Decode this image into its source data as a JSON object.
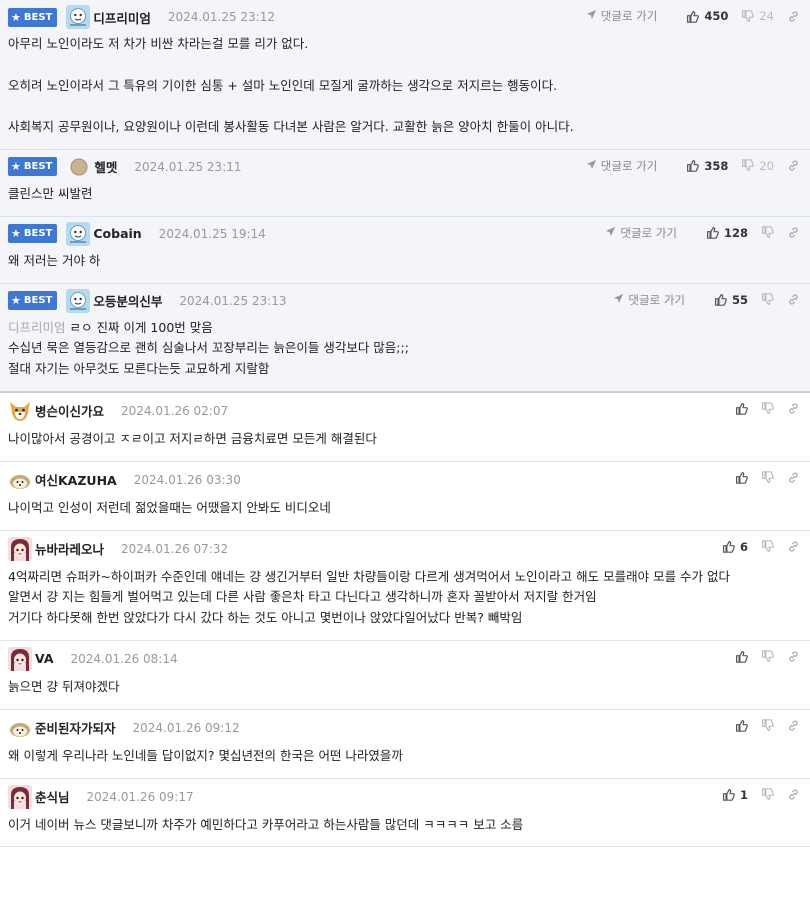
{
  "labels": {
    "best_badge": "BEST",
    "reply_link": "댓글로 가기"
  },
  "comments": [
    {
      "best": true,
      "nick": "디프리미엄",
      "avatar": "ice-character",
      "date": "2024.01.25 23:12",
      "likes": "450",
      "dislikes": "24",
      "lines": [
        "아무리 노인이라도 저 차가 비싼 차라는걸 모를 리가 없다.",
        "",
        "오히려 노인이라서 그 특유의 기이한 심통 + 설마 노인인데 모질게 굴까하는 생각으로 저지르는 행동이다.",
        "",
        "사회복지 공무원이나, 요양원이나 이런데 봉사활동 다녀본 사람은 알거다. 교활한 늙은 양아치 한둘이 아니다."
      ]
    },
    {
      "best": true,
      "nick": "헬멧",
      "avatar": "brown-dot",
      "date": "2024.01.25 23:11",
      "likes": "358",
      "dislikes": "20",
      "lines": [
        "클린스만 씨발련"
      ]
    },
    {
      "best": true,
      "nick": "Cobain",
      "avatar": "ice-character",
      "date": "2024.01.25 19:14",
      "likes": "128",
      "dislikes": "",
      "lines": [
        "왜 저러는 거야 하"
      ]
    },
    {
      "best": true,
      "nick": "오등분의신부",
      "avatar": "ice-character",
      "date": "2024.01.25 23:13",
      "likes": "55",
      "dislikes": "",
      "quote": "디프리미엄",
      "lines": [
        "ㄹㅇ 진짜 이게 100번 맞음",
        "수십년 묵은 열등감으로 괜히 심술나서 꼬장부리는 늙은이들 생각보다 많음;;;",
        "절대 자기는 아무것도 모른다는듯 교묘하게 지랄함"
      ]
    },
    {
      "best": false,
      "nick": "병슨이신가요",
      "avatar": "dog",
      "date": "2024.01.26 02:07",
      "likes": "",
      "dislikes": "",
      "lines": [
        "나이많아서 공경이고 ㅈㄹ이고 저지ㄹ하면 금융치료면 모든게 해결된다"
      ]
    },
    {
      "best": false,
      "nick": "여신KAZUHA",
      "avatar": "hedgehog",
      "date": "2024.01.26 03:30",
      "likes": "",
      "dislikes": "",
      "lines": [
        "나이먹고 인성이 저런데 젊었을때는 어땠을지 안봐도 비디오네"
      ]
    },
    {
      "best": false,
      "nick": "뉴바라레오나",
      "avatar": "girl",
      "date": "2024.01.26 07:32",
      "likes": "6",
      "dislikes": "",
      "lines": [
        "4억짜리면 슈퍼카~하이퍼카 수준인데 얘네는 걍 생긴거부터 일반 차량들이랑 다르게 생겨먹어서 노인이라고 해도 모를래야 모를 수가 없다",
        "알면서 걍 지는 힘들게 벌어먹고 있는데 다른 사람 좋은차 타고 다닌다고 생각하니까 혼자 꼴받아서 저지랄 한거임",
        "거기다 하다못해 한번 앉았다가 다시 갔다 하는 것도 아니고 몇번이나 앉았다일어났다 반복? 빼박임"
      ]
    },
    {
      "best": false,
      "nick": "VA",
      "avatar": "girl",
      "date": "2024.01.26 08:14",
      "likes": "",
      "dislikes": "",
      "lines": [
        "늙으면 걍 뒤져야겠다"
      ]
    },
    {
      "best": false,
      "nick": "준비된자가되자",
      "avatar": "hedgehog",
      "date": "2024.01.26 09:12",
      "likes": "",
      "dislikes": "",
      "lines": [
        "왜 이렇게 우리나라 노인네들 답이없지? 몇십년전의 한국은 어떤 나라였을까"
      ]
    },
    {
      "best": false,
      "nick": "춘식님",
      "avatar": "girl",
      "date": "2024.01.26 09:17",
      "likes": "1",
      "dislikes": "",
      "lines": [
        "이거 네이버 뉴스 댓글보니까 차주가 예민하다고 카푸어라고 하는사람들 많던데 ㅋㅋㅋㅋ 보고 소름"
      ]
    }
  ]
}
